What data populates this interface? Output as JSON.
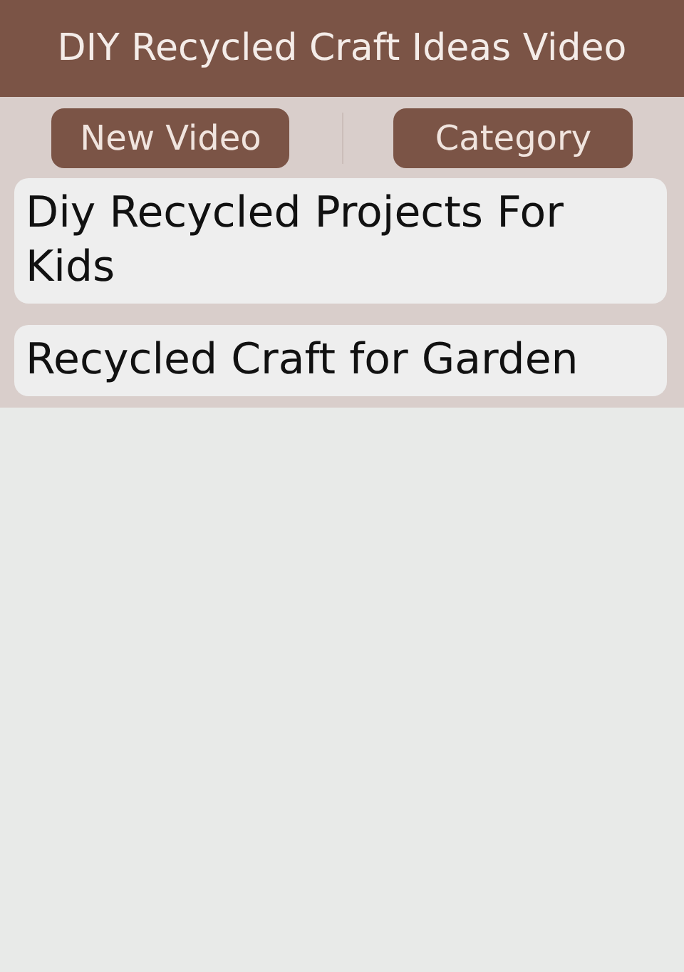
{
  "header": {
    "title": "DIY Recycled Craft Ideas Video"
  },
  "tabs": [
    {
      "label": "New Video"
    },
    {
      "label": "Category"
    }
  ],
  "items": [
    {
      "title": "Diy Recycled Projects For Kids"
    },
    {
      "title": "Recycled Craft for Garden"
    }
  ]
}
